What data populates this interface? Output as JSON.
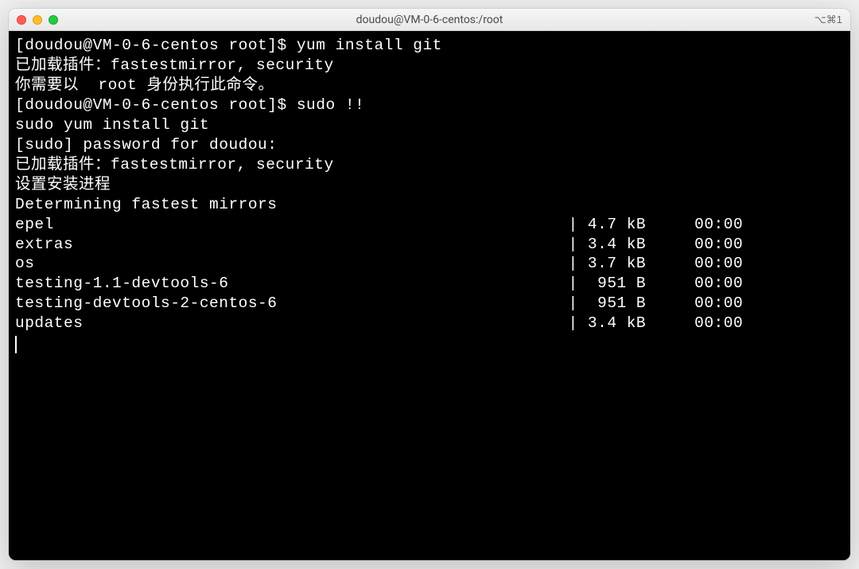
{
  "titlebar": {
    "title": "doudou@VM-0-6-centos:/root",
    "shortcut": "⌥⌘1"
  },
  "terminal": {
    "lines": [
      "[doudou@VM-0-6-centos root]$ yum install git",
      "已加载插件：fastestmirror, security",
      "你需要以  root 身份执行此命令。",
      "[doudou@VM-0-6-centos root]$ sudo !!",
      "sudo yum install git",
      "[sudo] password for doudou:",
      "已加载插件：fastestmirror, security",
      "设置安装进程",
      "Determining fastest mirrors",
      "epel                                                     | 4.7 kB     00:00",
      "extras                                                   | 3.4 kB     00:00",
      "os                                                       | 3.7 kB     00:00",
      "",
      "testing-1.1-devtools-6                                   |  951 B     00:00",
      "testing-devtools-2-centos-6                              |  951 B     00:00",
      "updates                                                  | 3.4 kB     00:00"
    ]
  }
}
